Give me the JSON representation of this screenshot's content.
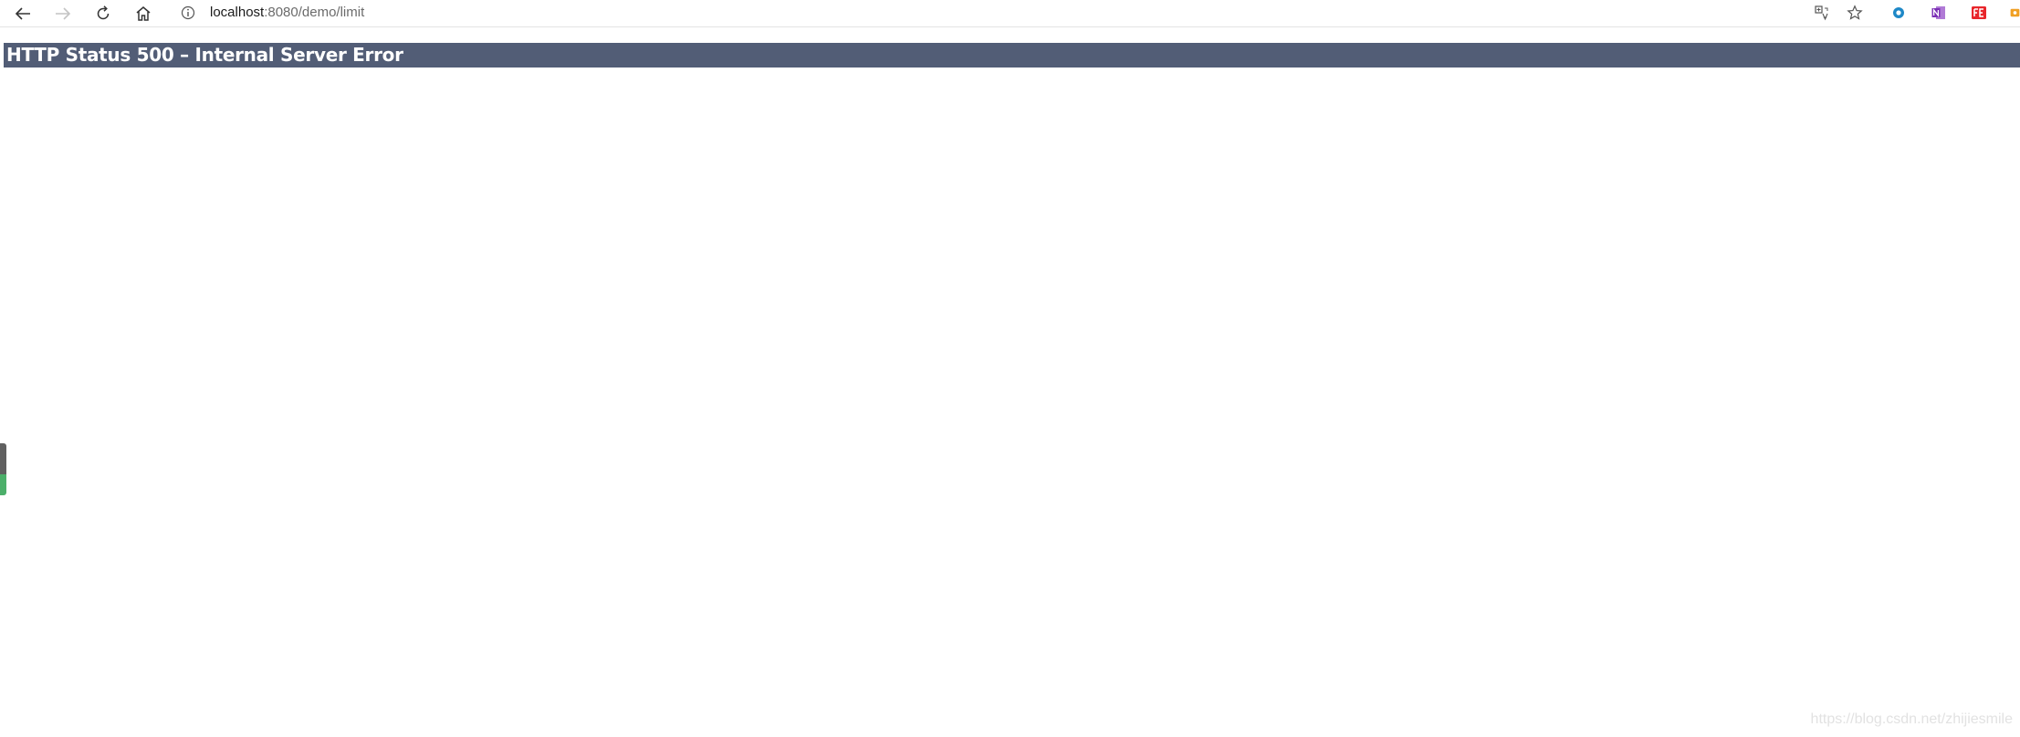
{
  "browser": {
    "url_host": "localhost",
    "url_rest": ":8080/demo/limit",
    "icons": [
      "back-icon",
      "forward-icon",
      "refresh-icon",
      "home-icon",
      "info-icon",
      "translate-icon",
      "star-icon"
    ],
    "extensions": [
      "extension-blue-circle-icon",
      "onenote-icon",
      "fe-extension-icon",
      "extension-orange-icon"
    ]
  },
  "page": {
    "error_title": "HTTP Status 500 – Internal Server Error",
    "header_color": "#525d76",
    "watermark": "https://blog.csdn.net/zhijiesmile"
  }
}
